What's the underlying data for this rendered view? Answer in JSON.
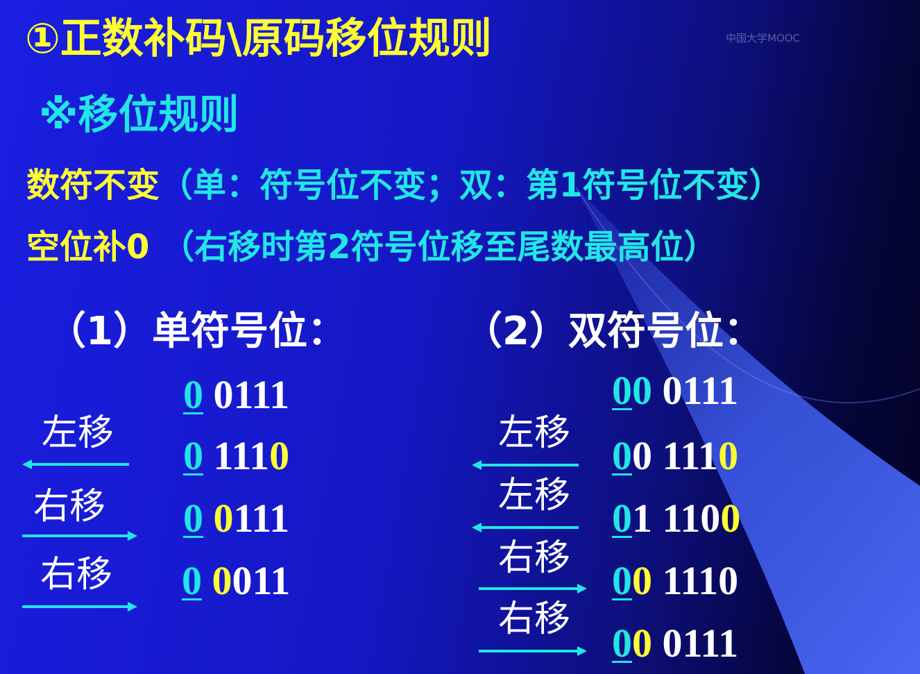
{
  "slide": {
    "title": "①正数补码\\原码移位规则",
    "subtitle": "※移位规则",
    "rule1_label": "数符不变",
    "rule1_detail": "（单：符号位不变；双：第1符号位不变）",
    "rule2_label": "空位补0",
    "rule2_detail": "（右移时第2符号位移至尾数最高位）"
  },
  "single": {
    "heading": "（1）单符号位：",
    "rows": [
      {
        "sign": "0",
        "mid": "",
        "bits": "0111",
        "fill": ""
      },
      {
        "sign": "0",
        "mid": "",
        "bits": "111",
        "fill": "0"
      },
      {
        "sign": "0",
        "mid": "0",
        "bits": "111",
        "fill": ""
      },
      {
        "sign": "0",
        "mid": "0",
        "bits": "011",
        "fill": ""
      }
    ],
    "ops": [
      {
        "label": "左移",
        "dir": "left"
      },
      {
        "label": "右移",
        "dir": "right"
      },
      {
        "label": "右移",
        "dir": "right"
      }
    ]
  },
  "double": {
    "heading": "（2）双符号位：",
    "rows": [
      {
        "sign1": "0",
        "sign2": "0",
        "bits": "0111",
        "fill": ""
      },
      {
        "sign1": "0",
        "sign2": "0",
        "bits": "111",
        "fill": "0"
      },
      {
        "sign1": "0",
        "sign2": "1",
        "bits": "110",
        "fill": "0"
      },
      {
        "sign1": "0",
        "sign2": "0",
        "bits": "1110",
        "fill": ""
      },
      {
        "sign1": "0",
        "sign2": "0",
        "bits": "0111",
        "fill": ""
      }
    ],
    "ops": [
      {
        "label": "左移",
        "dir": "left"
      },
      {
        "label": "左移",
        "dir": "left"
      },
      {
        "label": "右移",
        "dir": "right"
      },
      {
        "label": "右移",
        "dir": "right"
      }
    ]
  },
  "colors": {
    "title": "#ffff33",
    "highlight": "#ffff33",
    "sign": "#22e6e6",
    "arrow": "#22e6e6",
    "text": "#ffffff",
    "background": "#1518c4"
  },
  "watermark": "中国大学MOOC"
}
